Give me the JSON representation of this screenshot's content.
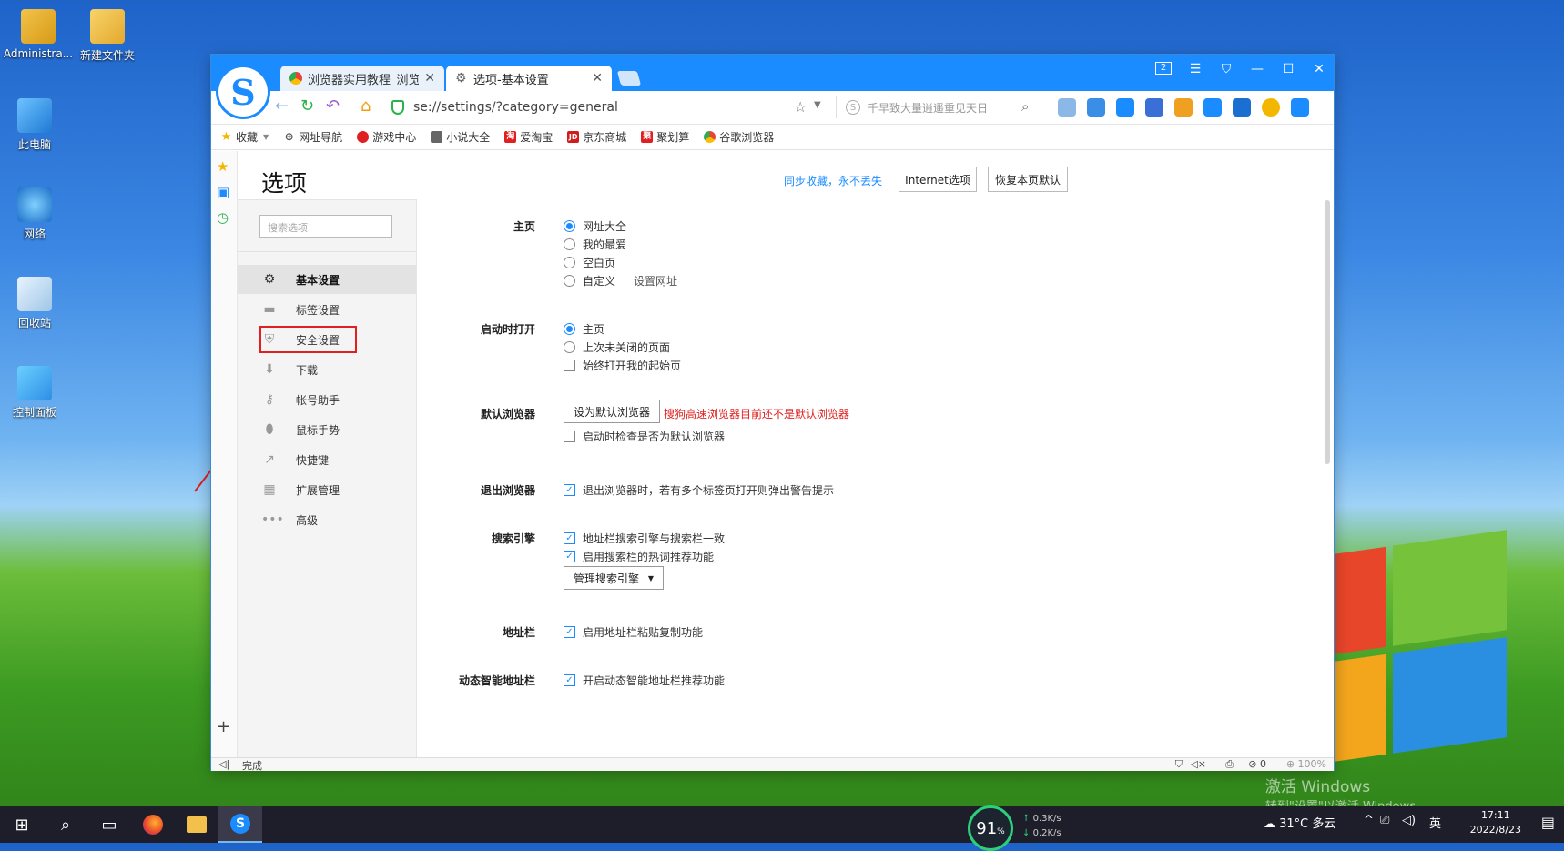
{
  "desktop": {
    "icons": [
      {
        "label": "Administra..."
      },
      {
        "label": "新建文件夹"
      },
      {
        "label": "此电脑"
      },
      {
        "label": "网络"
      },
      {
        "label": "回收站"
      },
      {
        "label": "控制面板"
      }
    ],
    "activate_title": "激活 Windows",
    "activate_sub": "转到\"设置\"以激活 Windows。"
  },
  "browser": {
    "tabs": [
      {
        "label": "浏览器实用教程_浏览器"
      },
      {
        "label": "选项-基本设置"
      }
    ],
    "titlebar_badge": "2",
    "url": "se://settings/?category=general",
    "search_placeholder": "千早致大量逍遥重见天日",
    "bookmarks": [
      {
        "label": "收藏"
      },
      {
        "label": "网址导航"
      },
      {
        "label": "游戏中心"
      },
      {
        "label": "小说大全"
      },
      {
        "label": "爱淘宝"
      },
      {
        "label": "京东商城"
      },
      {
        "label": "聚划算"
      },
      {
        "label": "谷歌浏览器"
      }
    ],
    "bookmark_badges": {
      "taobao": "淘",
      "jd": "JD",
      "juhuasuan": "聚"
    },
    "status": {
      "left": "完成",
      "counter": "0",
      "zoom": "100%"
    }
  },
  "settings": {
    "title": "选项",
    "sync_link": "同步收藏，永不丢失",
    "internet_btn": "Internet选项",
    "restore_btn": "恢复本页默认",
    "search_placeholder": "搜索选项",
    "nav": [
      {
        "label": "基本设置"
      },
      {
        "label": "标签设置"
      },
      {
        "label": "安全设置"
      },
      {
        "label": "下载"
      },
      {
        "label": "帐号助手"
      },
      {
        "label": "鼠标手势"
      },
      {
        "label": "快捷键"
      },
      {
        "label": "扩展管理"
      },
      {
        "label": "高级"
      }
    ],
    "homepage": {
      "label": "主页",
      "options": [
        "网址大全",
        "我的最爱",
        "空白页",
        "自定义"
      ],
      "set_url": "设置网址"
    },
    "startup": {
      "label": "启动时打开",
      "options": [
        "主页",
        "上次未关闭的页面"
      ],
      "checkbox": "始终打开我的起始页"
    },
    "default_browser": {
      "label": "默认浏览器",
      "button": "设为默认浏览器",
      "warning": "搜狗高速浏览器目前还不是默认浏览器",
      "checkbox": "启动时检查是否为默认浏览器"
    },
    "exit": {
      "label": "退出浏览器",
      "checkbox": "退出浏览器时，若有多个标签页打开则弹出警告提示"
    },
    "search_engine": {
      "label": "搜索引擎",
      "checks": [
        "地址栏搜索引擎与搜索栏一致",
        "启用搜索栏的热词推荐功能"
      ],
      "button": "管理搜索引擎"
    },
    "addressbar": {
      "label": "地址栏",
      "checkbox": "启用地址栏粘贴复制功能"
    },
    "smart_bar": {
      "label": "动态智能地址栏",
      "checkbox": "开启动态智能地址栏推荐功能"
    }
  },
  "taskbar": {
    "net_percent": "91",
    "net_unit": "%",
    "upload": "0.3K/s",
    "download": "0.2K/s",
    "weather": "31°C 多云",
    "ime": "英",
    "time": "17:11",
    "date": "2022/8/23"
  },
  "colors": {
    "accent": "#1b8cff",
    "warning": "#e02020",
    "highlight_box": "#e02020"
  }
}
